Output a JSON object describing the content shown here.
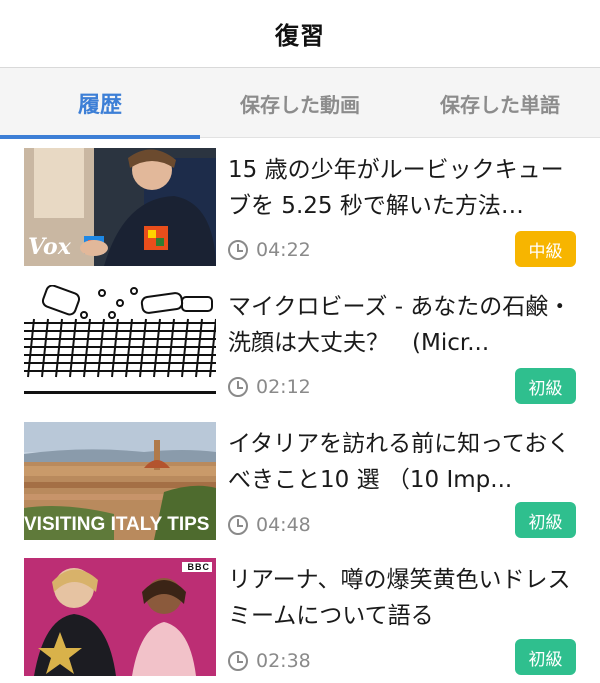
{
  "header": {
    "title": "復習"
  },
  "tabs": [
    {
      "label": "履歴",
      "active": true
    },
    {
      "label": "保存した動画",
      "active": false
    },
    {
      "label": "保存した単語",
      "active": false
    }
  ],
  "videos": [
    {
      "title": "15 歳の少年がルービックキューブを 5.25 秒で解いた方法…",
      "duration": "04:22",
      "level": "中級",
      "level_color": "#f7b500",
      "thumb_caption": "Vox",
      "icon": "rubiks-cube-thumbnail"
    },
    {
      "title": "マイクロビーズ - あなたの石鹸・洗顔は大丈夫？　(Micr...",
      "duration": "02:12",
      "level": "初級",
      "level_color": "#2fbf8e",
      "thumb_caption": "",
      "icon": "microbeads-thumbnail"
    },
    {
      "title": "イタリアを訪れる前に知っておくべきこと10 選 （10 Imp...",
      "duration": "04:48",
      "level": "初級",
      "level_color": "#2fbf8e",
      "thumb_caption": "VISITING ITALY TIPS",
      "icon": "italy-city-thumbnail"
    },
    {
      "title": "リアーナ、噂の爆笑黄色いドレスミームについて語る",
      "duration": "02:38",
      "level": "初級",
      "level_color": "#2fbf8e",
      "thumb_caption": "BBC",
      "icon": "talk-show-thumbnail"
    }
  ],
  "colors": {
    "accent": "#3d7fd6",
    "muted": "#8a8a8a",
    "intermediate": "#f7b500",
    "beginner": "#2fbf8e"
  }
}
